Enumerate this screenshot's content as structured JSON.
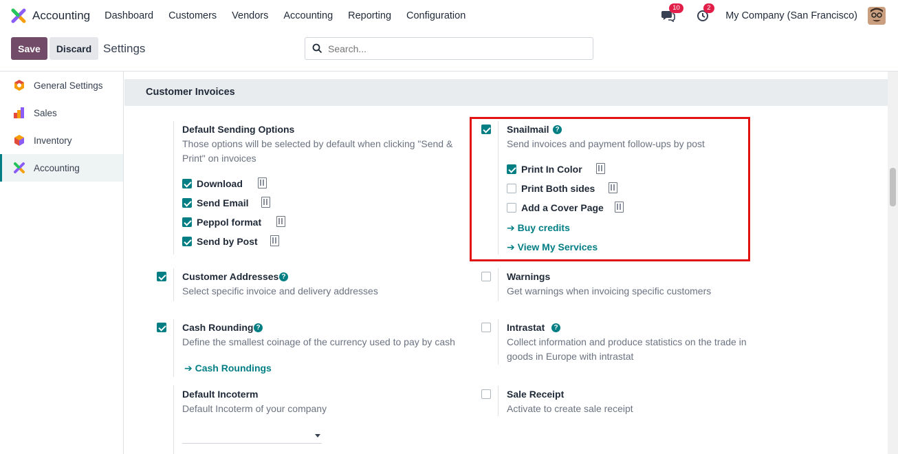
{
  "nav": {
    "app_name": "Accounting",
    "menu": [
      "Dashboard",
      "Customers",
      "Vendors",
      "Accounting",
      "Reporting",
      "Configuration"
    ],
    "messages_count": "10",
    "activities_count": "2",
    "company": "My Company (San Francisco)"
  },
  "control": {
    "save_label": "Save",
    "discard_label": "Discard",
    "title": "Settings",
    "search_placeholder": "Search..."
  },
  "sidebar": {
    "items": [
      {
        "label": "General Settings",
        "icon": "settings-gear-icon"
      },
      {
        "label": "Sales",
        "icon": "sales-chart-icon"
      },
      {
        "label": "Inventory",
        "icon": "inventory-box-icon"
      },
      {
        "label": "Accounting",
        "icon": "accounting-logo-icon",
        "active": true
      }
    ]
  },
  "section": {
    "title": "Customer Invoices"
  },
  "default_sending": {
    "title": "Default Sending Options",
    "desc": "Those options will be selected by default when clicking \"Send & Print\" on invoices",
    "options": [
      {
        "label": "Download",
        "checked": true
      },
      {
        "label": "Send Email",
        "checked": true
      },
      {
        "label": "Peppol format",
        "checked": true
      },
      {
        "label": "Send by Post",
        "checked": true
      }
    ]
  },
  "snailmail": {
    "title": "Snailmail",
    "checked": true,
    "desc": "Send invoices and payment follow-ups by post",
    "options": [
      {
        "label": "Print In Color",
        "checked": true
      },
      {
        "label": "Print Both sides",
        "checked": false
      },
      {
        "label": "Add a Cover Page",
        "checked": false
      }
    ],
    "link_buy": "➔ Buy credits",
    "link_services": "➔ View My Services"
  },
  "customer_addresses": {
    "title": "Customer Addresses",
    "checked": true,
    "desc": "Select specific invoice and delivery addresses"
  },
  "warnings": {
    "title": "Warnings",
    "checked": false,
    "desc": "Get warnings when invoicing specific customers"
  },
  "cash_rounding": {
    "title": "Cash Rounding",
    "checked": true,
    "desc": "Define the smallest coinage of the currency used to pay by cash",
    "link": "➔ Cash Roundings"
  },
  "intrastat": {
    "title": "Intrastat",
    "checked": false,
    "desc": "Collect information and produce statistics on the trade in goods in Europe with intrastat"
  },
  "incoterm": {
    "title": "Default Incoterm",
    "desc": "Default Incoterm of your company",
    "value": ""
  },
  "sale_receipt": {
    "title": "Sale Receipt",
    "checked": false,
    "desc": "Activate to create sale receipt"
  },
  "colors": {
    "primary": "#714b67",
    "teal": "#017e84",
    "highlight": "#e11212"
  }
}
